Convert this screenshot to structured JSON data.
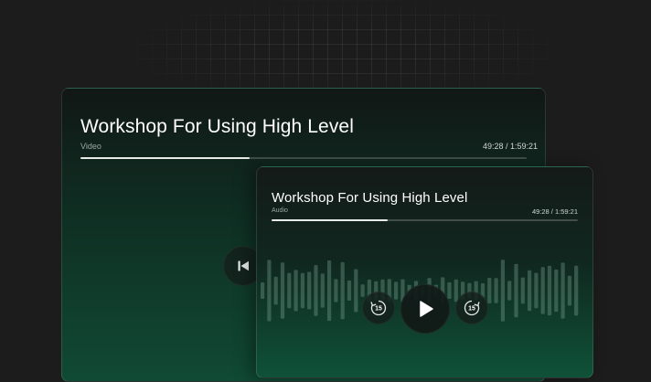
{
  "video_player": {
    "title": "Workshop For Using High Level",
    "kind_label": "Video",
    "time": "49:28 / 1:59:21",
    "progress": 0.38
  },
  "audio_player": {
    "title": "Workshop For Using High Level",
    "kind_label": "Audio",
    "time": "49:28 / 1:59:21",
    "progress": 0.38,
    "skip_back_seconds": "15",
    "skip_forward_seconds": "15"
  },
  "icons": {
    "previous": "skip-previous-icon",
    "play": "play-icon",
    "rewind": "rewind-15-icon",
    "forward": "forward-15-icon"
  },
  "colors": {
    "background": "#1c1c1c",
    "card_green": "#0f5238",
    "progress_fill": "#e8ece9"
  }
}
